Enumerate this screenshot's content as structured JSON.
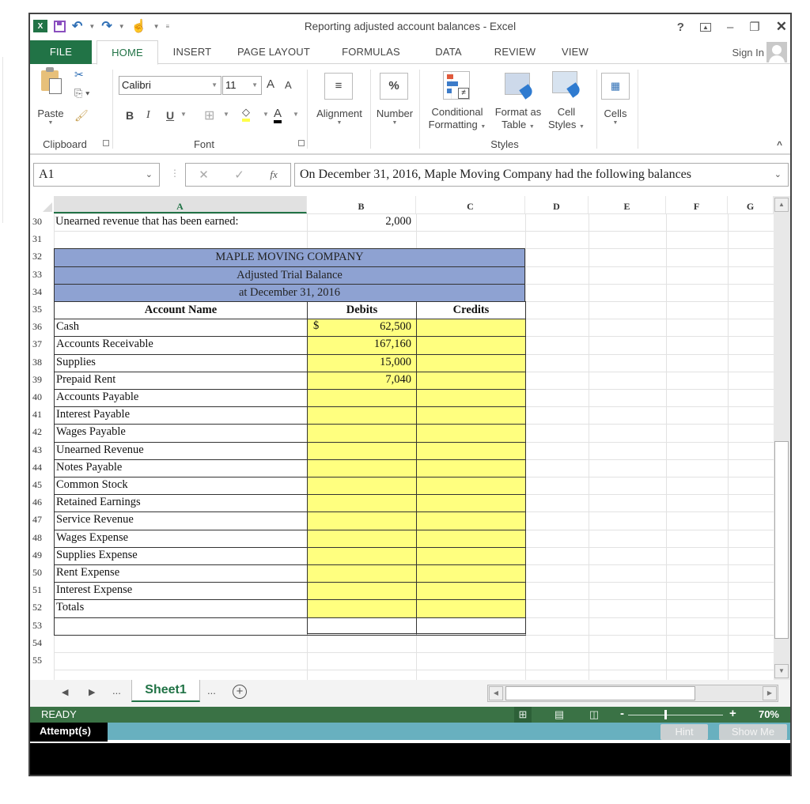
{
  "window": {
    "title": "Reporting adjusted account balances - Excel",
    "controls": {
      "help": "?",
      "ribbon_display": "⇱",
      "minimize": "–",
      "restore": "🗗",
      "close": "✕"
    }
  },
  "quick_access": {
    "logo": "X",
    "undo": "↶",
    "redo": "↷",
    "touch": "☝"
  },
  "tabs": [
    {
      "label": "FILE"
    },
    {
      "label": "HOME"
    },
    {
      "label": "INSERT"
    },
    {
      "label": "PAGE LAYOUT"
    },
    {
      "label": "FORMULAS"
    },
    {
      "label": "DATA"
    },
    {
      "label": "REVIEW"
    },
    {
      "label": "VIEW"
    }
  ],
  "sign_in": "Sign In",
  "ribbon": {
    "clipboard": {
      "paste": "Paste",
      "group": "Clipboard"
    },
    "font": {
      "name": "Calibri",
      "size": "11",
      "bold": "B",
      "italic": "I",
      "underline": "U",
      "grow": "A",
      "shrink": "A",
      "font_color": "A",
      "group": "Font"
    },
    "alignment": {
      "label": "Alignment",
      "icon": "≡"
    },
    "number": {
      "label": "Number",
      "icon": "%"
    },
    "styles": {
      "conditional_1": "Conditional",
      "conditional_2": "Formatting",
      "format_table_1": "Format as",
      "format_table_2": "Table",
      "cell_styles_1": "Cell",
      "cell_styles_2": "Styles",
      "group": "Styles"
    },
    "cells": {
      "label": "Cells"
    },
    "collapse": "^"
  },
  "formula_bar": {
    "name_box": "A1",
    "cancel": "✕",
    "enter": "✓",
    "fx": "fx",
    "content": "On December 31, 2016, Maple Moving Company had the following balances"
  },
  "sheet": {
    "columns": [
      "A",
      "B",
      "C",
      "D",
      "E",
      "F",
      "G"
    ],
    "rows": [
      "30",
      "31",
      "32",
      "33",
      "34",
      "35",
      "36",
      "37",
      "38",
      "39",
      "40",
      "41",
      "42",
      "43",
      "44",
      "45",
      "46",
      "47",
      "48",
      "49",
      "50",
      "51",
      "52",
      "53",
      "54",
      "55"
    ],
    "row30": {
      "label": "Unearned revenue that has been earned:",
      "value": "2,000"
    },
    "title_lines": [
      "MAPLE MOVING COMPANY",
      "Adjusted Trial Balance",
      "at December 31, 2016"
    ],
    "headers": {
      "account": "Account Name",
      "debits": "Debits",
      "credits": "Credits"
    },
    "accounts": [
      {
        "name": "Cash",
        "debit": "62,500",
        "currency": "$",
        "credit": ""
      },
      {
        "name": "Accounts Receivable",
        "debit": "167,160",
        "credit": ""
      },
      {
        "name": "Supplies",
        "debit": "15,000",
        "credit": ""
      },
      {
        "name": "Prepaid Rent",
        "debit": "7,040",
        "credit": ""
      },
      {
        "name": "Accounts Payable",
        "debit": "",
        "credit": ""
      },
      {
        "name": "Interest Payable",
        "debit": "",
        "credit": ""
      },
      {
        "name": "Wages Payable",
        "debit": "",
        "credit": ""
      },
      {
        "name": "Unearned Revenue",
        "debit": "",
        "credit": ""
      },
      {
        "name": "Notes Payable",
        "debit": "",
        "credit": ""
      },
      {
        "name": "Common Stock",
        "debit": "",
        "credit": ""
      },
      {
        "name": "Retained Earnings",
        "debit": "",
        "credit": ""
      },
      {
        "name": "Service Revenue",
        "debit": "",
        "credit": ""
      },
      {
        "name": "Wages Expense",
        "debit": "",
        "credit": ""
      },
      {
        "name": "Supplies Expense",
        "debit": "",
        "credit": ""
      },
      {
        "name": "Rent Expense",
        "debit": "",
        "credit": ""
      },
      {
        "name": "Interest Expense",
        "debit": "",
        "credit": ""
      },
      {
        "name": "Totals",
        "debit": "",
        "credit": ""
      }
    ]
  },
  "sheet_tabs": {
    "prev": "◀",
    "next": "▶",
    "ellipsis_left": "...",
    "active": "Sheet1",
    "ellipsis_right": "...",
    "add": "+"
  },
  "status": {
    "state": "READY",
    "zoom_minus": "-",
    "zoom_plus": "+",
    "zoom": "70%",
    "zoom_level_percent": 70
  },
  "assessment": {
    "attempts": "Attempt(s)",
    "hint": "Hint",
    "show_me": "Show Me"
  },
  "colors": {
    "excel_green": "#217346",
    "status_green": "#3a7245",
    "title_band": "#8ea2d2",
    "input_yellow": "#ffff7f",
    "attempt_bar": "#68b0bf"
  }
}
